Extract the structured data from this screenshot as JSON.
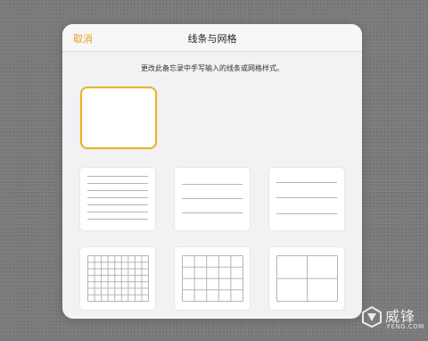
{
  "navbar": {
    "cancel_label": "取消",
    "title": "线条与网格"
  },
  "description": "更改此备忘录中手写输入的线条或网格样式。",
  "options": [
    {
      "name": "blank",
      "selected": true
    },
    {
      "name": "lines-small",
      "selected": false
    },
    {
      "name": "lines-medium",
      "selected": false
    },
    {
      "name": "lines-large",
      "selected": false
    },
    {
      "name": "grid-small",
      "selected": false
    },
    {
      "name": "grid-medium",
      "selected": false
    },
    {
      "name": "grid-large",
      "selected": false
    }
  ],
  "colors": {
    "accent": "#e4a21a",
    "selection_border": "#e8b51f",
    "sheet_background": "#f2f2f4",
    "page_background": "#7a7a7c"
  },
  "watermark": {
    "icon": "feng-logo-icon",
    "brand": "威锋",
    "domain": "FENG.COM"
  }
}
